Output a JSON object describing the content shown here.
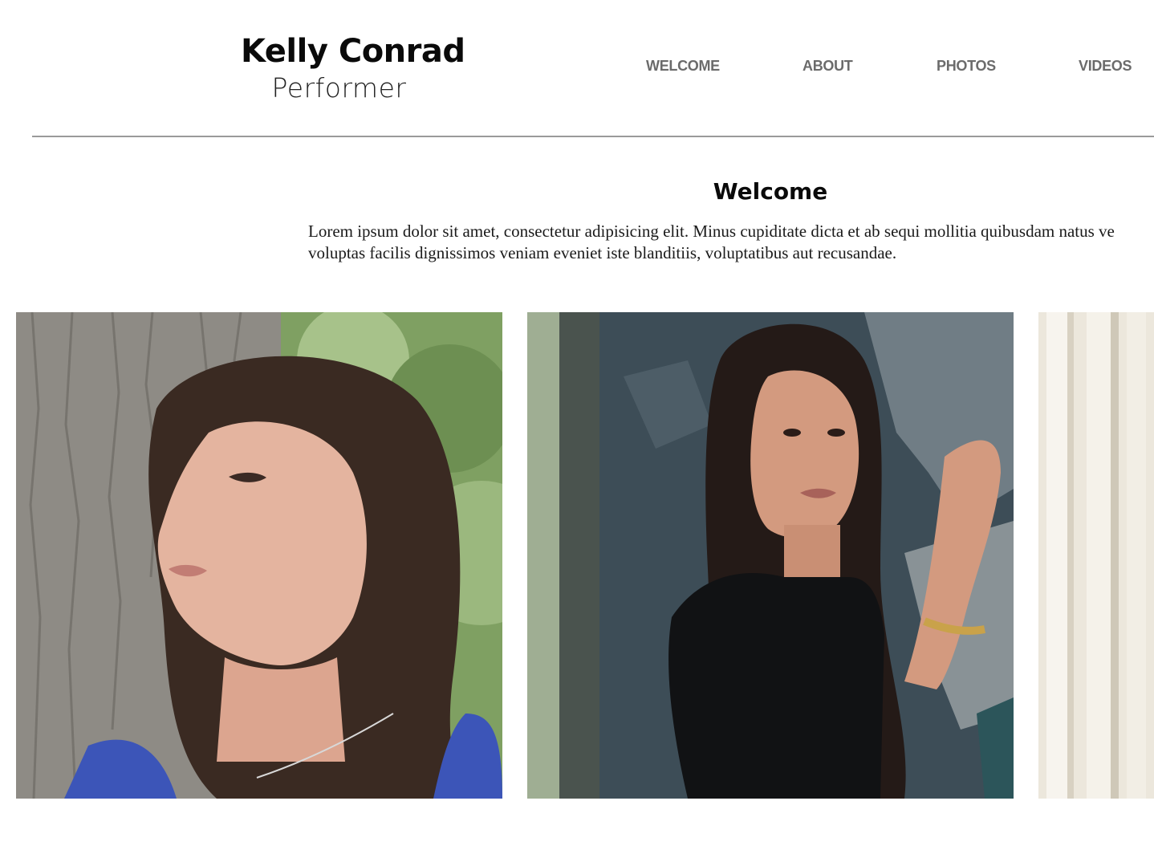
{
  "header": {
    "name": "Kelly Conrad",
    "role": "Performer"
  },
  "nav": {
    "items": [
      {
        "label": "WELCOME"
      },
      {
        "label": "ABOUT"
      },
      {
        "label": "PHOTOS"
      },
      {
        "label": "VIDEOS"
      }
    ]
  },
  "welcome": {
    "title": "Welcome",
    "text_line1": "Lorem ipsum dolor sit amet, consectetur adipisicing elit. Minus cupiditate dicta et ab sequi mollitia quibusdam natus ve",
    "text_line2": "voluptas facilis dignissimos veniam eveniet iste blanditiis, voluptatibus aut recusandae."
  },
  "colors": {
    "nav_text": "#6b6b6b",
    "divider": "#9a9a9a",
    "background": "#ffffff"
  }
}
